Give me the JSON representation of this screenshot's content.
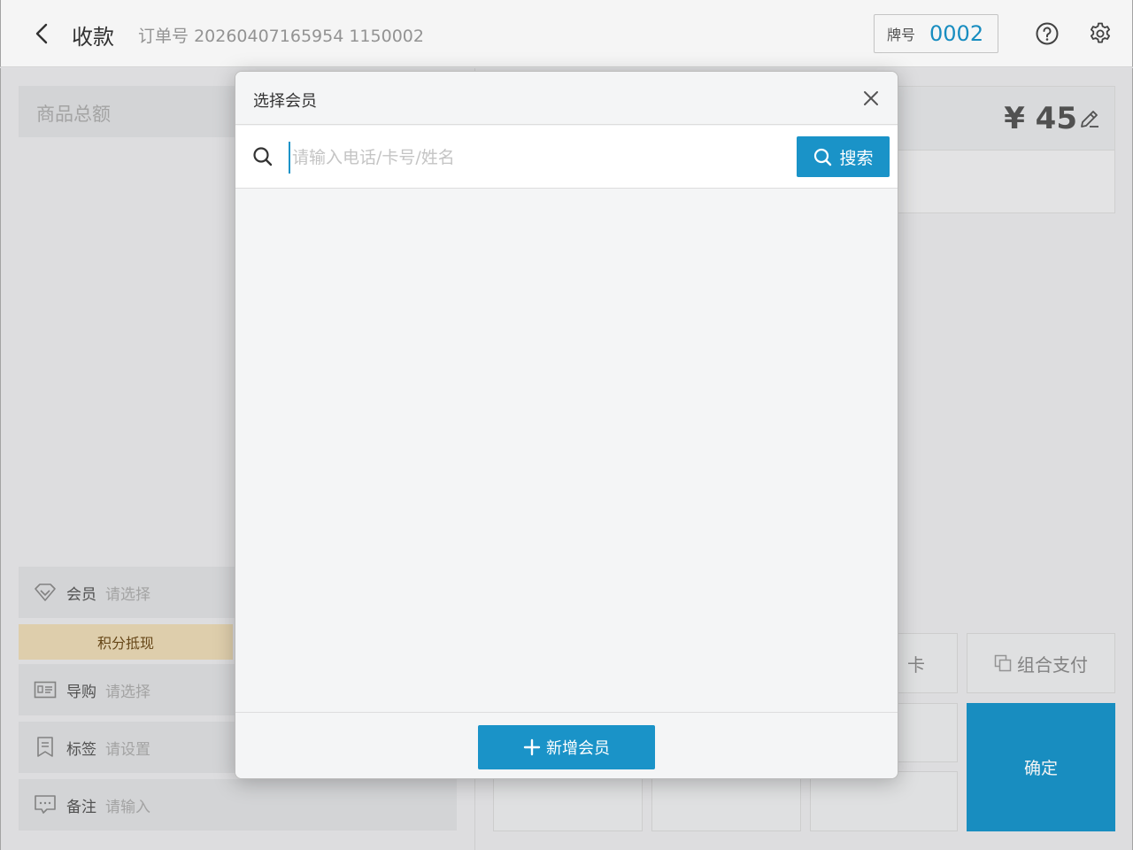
{
  "header": {
    "title": "收款",
    "order_label": "订单号",
    "order_number": "20260407165954 1150002",
    "plate_label": "牌号",
    "plate_number": "0002"
  },
  "left": {
    "total_label": "商品总额",
    "member": {
      "label": "会员",
      "value": "请选择"
    },
    "points_button": "积分抵现",
    "guide": {
      "label": "导购",
      "value": "请选择"
    },
    "tag": {
      "label": "标签",
      "value": "请设置"
    },
    "note": {
      "label": "备注",
      "value": "请输入"
    }
  },
  "right": {
    "amount": "¥ 45",
    "card_button_partial": "卡",
    "combo_pay": "组合支付",
    "confirm": "确定"
  },
  "modal": {
    "title": "选择会员",
    "search_placeholder": "请输入电话/卡号/姓名",
    "search_value": "",
    "search_button": "搜索",
    "add_member_button": "新增会员"
  },
  "colors": {
    "accent": "#1a93c8",
    "points_bg": "#e8d7b4"
  }
}
